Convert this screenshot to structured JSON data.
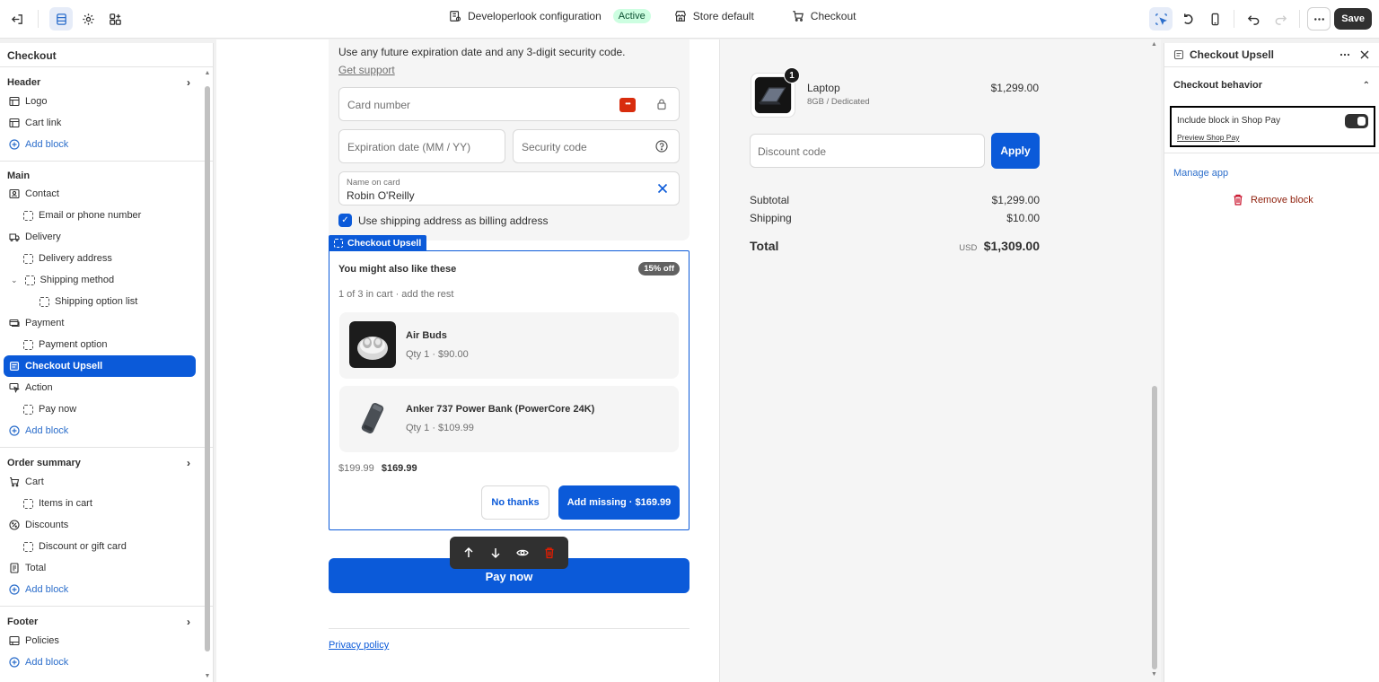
{
  "topbar": {
    "config_name": "Developerlook configuration",
    "status": "Active",
    "store": "Store default",
    "page": "Checkout",
    "save_label": "Save"
  },
  "sidebar": {
    "title": "Checkout",
    "header": {
      "label": "Header",
      "items": [
        "Logo",
        "Cart link"
      ],
      "add": "Add block"
    },
    "main": {
      "label": "Main",
      "contact": "Contact",
      "email": "Email or phone number",
      "delivery": "Delivery",
      "delivery_address": "Delivery address",
      "shipping_method": "Shipping method",
      "shipping_option_list": "Shipping option list",
      "payment": "Payment",
      "payment_option": "Payment option",
      "checkout_upsell": "Checkout Upsell",
      "action": "Action",
      "pay_now": "Pay now",
      "add": "Add block"
    },
    "order_summary": {
      "label": "Order summary",
      "cart": "Cart",
      "items_in_cart": "Items in cart",
      "discounts": "Discounts",
      "discount_or_gift": "Discount or gift card",
      "total": "Total",
      "add": "Add block"
    },
    "footer": {
      "label": "Footer",
      "policies": "Policies",
      "add": "Add block"
    }
  },
  "payment": {
    "note": "Use any future expiration date and any 3-digit security code.",
    "support_link": "Get support",
    "card_number_placeholder": "Card number",
    "expiration_placeholder": "Expiration date (MM / YY)",
    "security_placeholder": "Security code",
    "name_label": "Name on card",
    "name_value": "Robin O'Reilly",
    "billing_checkbox": "Use shipping address as billing address"
  },
  "upsell": {
    "tag": "Checkout Upsell",
    "title": "You might also like these",
    "badge": "15% off",
    "subtitle": "1 of 3 in cart · add the rest",
    "products": [
      {
        "name": "Air Buds",
        "qty": "Qty 1 · $90.00"
      },
      {
        "name": "Anker 737 Power Bank (PowerCore 24K)",
        "qty": "Qty 1 · $109.99"
      }
    ],
    "old_price": "$199.99",
    "new_price": "$169.99",
    "no_thanks": "No thanks",
    "add_missing": "Add missing · $169.99"
  },
  "pay_now": "Pay now",
  "privacy_policy": "Privacy policy",
  "order_summary": {
    "product_name": "Laptop",
    "product_variant": "8GB / Dedicated",
    "product_price": "$1,299.00",
    "product_qty": "1",
    "discount_placeholder": "Discount code",
    "apply": "Apply",
    "subtotal_label": "Subtotal",
    "subtotal_value": "$1,299.00",
    "shipping_label": "Shipping",
    "shipping_value": "$10.00",
    "total_label": "Total",
    "currency": "USD",
    "total_value": "$1,309.00"
  },
  "right_panel": {
    "title": "Checkout Upsell",
    "section": "Checkout behavior",
    "toggle_label": "Include block in Shop Pay",
    "toggle_link": "Preview Shop Pay",
    "manage_app": "Manage app",
    "remove_block": "Remove block"
  },
  "colors": {
    "accent": "#0b5ad9",
    "active_badge_bg": "#cdfee1",
    "danger": "#8e1f0b"
  }
}
